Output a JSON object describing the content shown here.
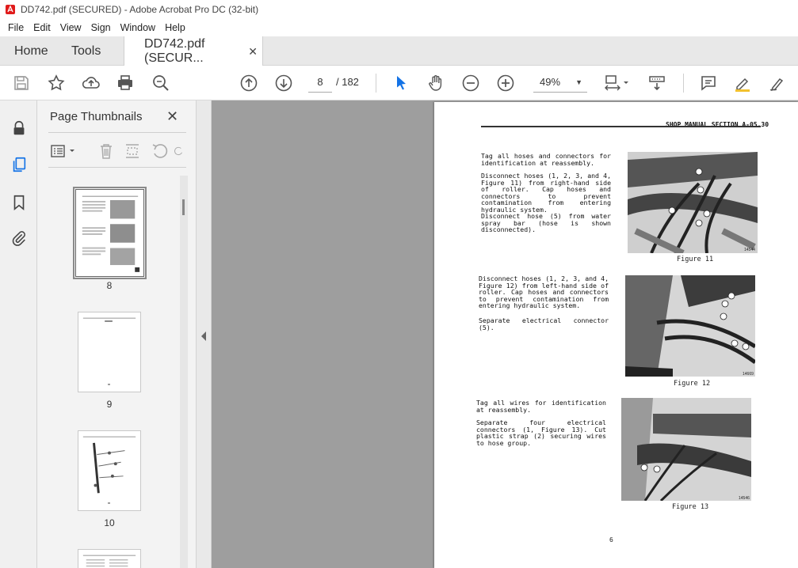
{
  "window": {
    "title": "DD742.pdf (SECURED) - Adobe Acrobat Pro DC (32-bit)"
  },
  "menu": [
    "File",
    "Edit",
    "View",
    "Sign",
    "Window",
    "Help"
  ],
  "tabs": {
    "home": "Home",
    "tools": "Tools",
    "doc": "DD742.pdf (SECUR...",
    "close": "✕"
  },
  "toolbar": {
    "page_current": "8",
    "page_total": "/  182",
    "zoom": "49%"
  },
  "panel": {
    "title": "Page Thumbnails",
    "close": "✕"
  },
  "thumbnails": [
    {
      "label": "8"
    },
    {
      "label": "9"
    },
    {
      "label": "10"
    }
  ],
  "document": {
    "header": "SHOP MANUAL SECTION A-05.30",
    "blocks": [
      "Tag  all  hoses  and  connectors  for identification at reassembly.",
      "Disconnect  hoses  (1,  2,  3,  and  4, Figure  11)  from  right-hand  side  of roller.  Cap  hoses  and  connectors  to prevent  contamination  from  entering hydraulic system.",
      "Disconnect  hose  (5)  from  water  spray bar (hose is shown disconnected).",
      "Disconnect  hoses  (1,  2,  3,  and  4, Figure  12)  from  left-hand  side  of roller.  Cap  hoses  and  connectors  to prevent  contamination  from  entering hydraulic system.",
      "Separate electrical connector (5).",
      "Tag  all  wires  for  identification  at reassembly.",
      "Separate  four  electrical  connectors (1, Figure 13).  Cut plastic strap (2) securing wires to hose group."
    ],
    "captions": [
      "Figure 11",
      "Figure 12",
      "Figure 13"
    ],
    "photo_ids": [
      "14544",
      "14669",
      "14546"
    ],
    "page_number": "6"
  },
  "colors": {
    "accent": "#1473e6",
    "tabbar": "#e8e8e8",
    "canvas": "#9e9e9e"
  }
}
